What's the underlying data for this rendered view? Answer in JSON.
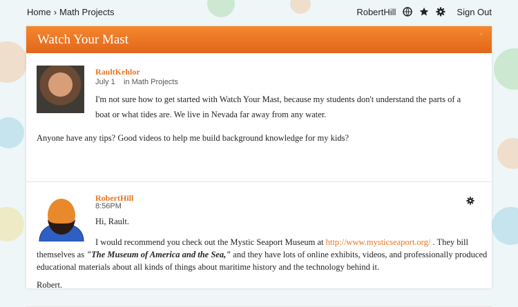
{
  "breadcrumb": {
    "home": "Home",
    "separator": "›",
    "current": "Math Projects"
  },
  "user": {
    "name": "RobertHill",
    "sign_out": "Sign Out"
  },
  "panel": {
    "title": "Watch Your Mast",
    "close_glyph": "×"
  },
  "posts": [
    {
      "author": "RaultKehlor",
      "date": "July 1",
      "location": "in Math Projects",
      "paragraphs": [
        "I'm not sure how to get started with Watch Your Mast, because my students don't understand the parts of a",
        "boat or what tides are.  We live in Nevada far away from any water.",
        "Anyone have any tips?  Good videos to help me build background knowledge for my kids?"
      ]
    },
    {
      "author": "RobertHill",
      "time": "8:56PM",
      "greeting": "Hi, Rault.",
      "rec_prefix": "I would recommend you check out the Mystic Seaport Museum at ",
      "link": "http://www.mysticseaport.org/",
      "rec_suffix": " .  They bill",
      "line2_prefix": "themselves as ",
      "quote": "\"The Museum of America and the Sea,\"",
      "line2_suffix": " and they have lots of online exhibits, videos, and professionally produced",
      "line3": "educational materials about all kinds of things about maritime history and the technology behind it.",
      "signoff": "Robert."
    }
  ],
  "colors": {
    "accent": "#e8741f",
    "header_top": "#f5872e",
    "header_bottom": "#e2661b"
  }
}
